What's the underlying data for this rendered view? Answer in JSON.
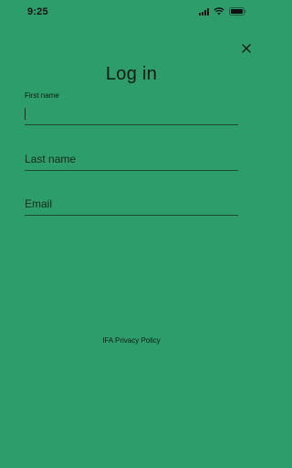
{
  "status_bar": {
    "time": "9:25",
    "icons": [
      "signal-icon",
      "wifi-icon",
      "battery-icon"
    ]
  },
  "header": {
    "title": "Log in",
    "close_icon": "close-icon"
  },
  "form": {
    "first_name": {
      "label": "First name",
      "value": ""
    },
    "last_name": {
      "placeholder": "Last name",
      "value": ""
    },
    "email": {
      "placeholder": "Email",
      "value": ""
    }
  },
  "footer": {
    "privacy_link": "IFA Privacy Policy"
  },
  "colors": {
    "background": "#2c9d6b",
    "text": "#0a1a12",
    "underline": "#1a4a33"
  }
}
